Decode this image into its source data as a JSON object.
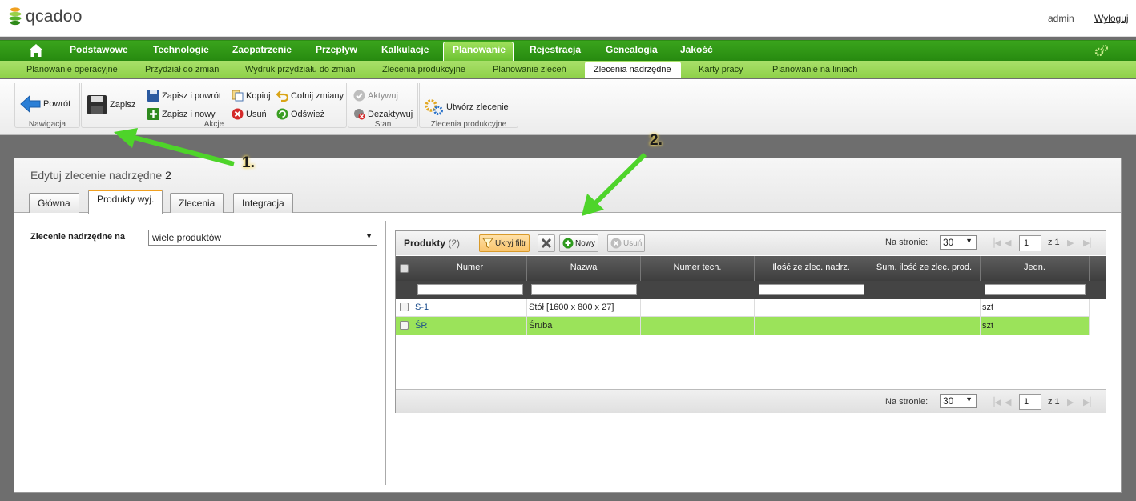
{
  "app": {
    "logo_text": "qcadoo",
    "user": "admin",
    "logout": "Wyloguj"
  },
  "main_nav": [
    "Podstawowe",
    "Technologie",
    "Zaopatrzenie",
    "Przepływ",
    "Kalkulacje",
    "Planowanie",
    "Rejestracja",
    "Genealogia",
    "Jakość"
  ],
  "sub_nav": [
    "Planowanie operacyjne",
    "Przydział do zmian",
    "Wydruk przydziału do zmian",
    "Zlecenia produkcyjne",
    "Planowanie zleceń",
    "Zlecenia nadrzędne",
    "Karty pracy",
    "Planowanie na liniach"
  ],
  "ribbon": {
    "nav": {
      "label": "Nawigacja",
      "back": "Powrót"
    },
    "actions": {
      "label": "Akcje",
      "save": "Zapisz",
      "save_back": "Zapisz i powrót",
      "save_new": "Zapisz i nowy",
      "copy": "Kopiuj",
      "delete": "Usuń",
      "undo": "Cofnij zmiany",
      "refresh": "Odśwież"
    },
    "state": {
      "label": "Stan",
      "activate": "Aktywuj",
      "deactivate": "Dezaktywuj"
    },
    "orders": {
      "label": "Zlecenia produkcyjne",
      "create": "Utwórz zlecenie"
    }
  },
  "form": {
    "title": "Edytuj zlecenie nadrzędne",
    "number": "2",
    "tabs": [
      "Główna",
      "Produkty wyj.",
      "Zlecenia",
      "Integracja"
    ],
    "field_label": "Zlecenie nadrzędne na",
    "field_value": "wiele produktów"
  },
  "grid": {
    "title": "Produkty",
    "count": "(2)",
    "filter_btn": "Ukryj filtr",
    "new_btn": "Nowy",
    "delete_btn": "Usuń",
    "per_page_label": "Na stronie:",
    "per_page": "30",
    "page": "1",
    "of": "z 1",
    "columns": [
      "Numer",
      "Nazwa",
      "Numer tech.",
      "Ilość ze zlec. nadrz.",
      "Sum. ilość ze zlec. prod.",
      "Jedn."
    ],
    "rows": [
      {
        "number": "S-1",
        "name": "Stół [1600 x 800 x 27]",
        "tech": "",
        "qty": "",
        "sum": "",
        "unit": "szt"
      },
      {
        "number": "ŚR",
        "name": "Śruba",
        "tech": "",
        "qty": "",
        "sum": "",
        "unit": "szt"
      }
    ]
  },
  "callouts": [
    "1.",
    "2."
  ],
  "colors": {
    "accent_green": "#3aa41c",
    "row_selected": "#9be35a",
    "callout_arrow": "#4ed42a"
  }
}
